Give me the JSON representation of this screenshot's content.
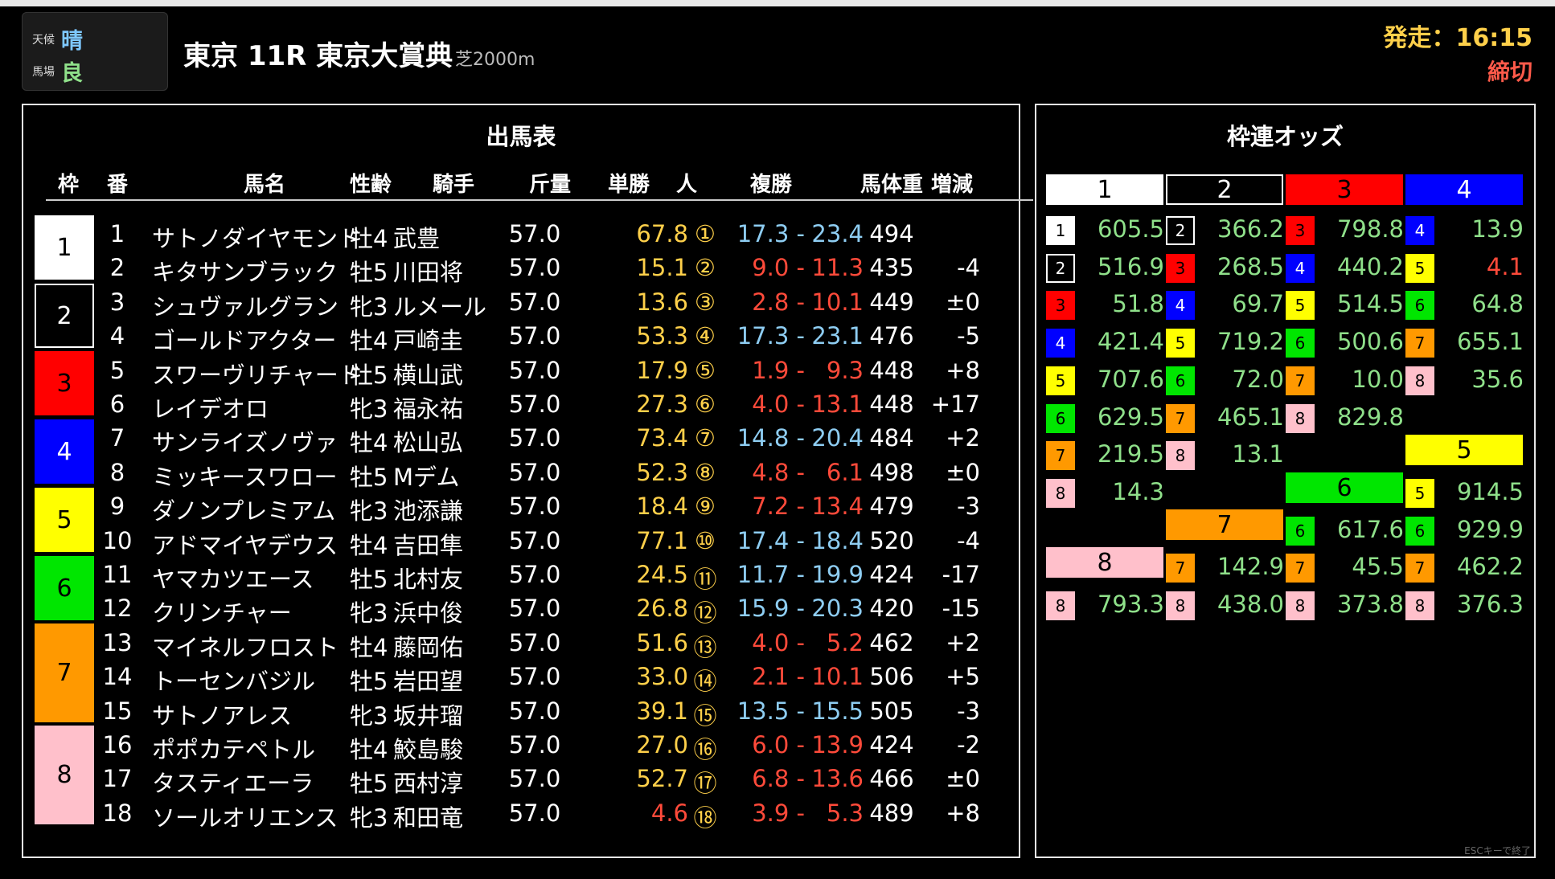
{
  "header": {
    "weather_label": "天候",
    "weather": "晴",
    "track_label": "馬場",
    "track": "良",
    "race_title": "東京 11R 東京大賞典",
    "course": "芝2000m",
    "start_time": "発走：16:15",
    "status": "締切",
    "esc_hint": "ESCキーで終了"
  },
  "colors": {
    "frame_1": "#ffffff",
    "frame_2": "#000000",
    "frame_3": "#ff0000",
    "frame_4": "#0000ff",
    "frame_5": "#ffff00",
    "frame_6": "#00e600",
    "frame_7": "#ff9900",
    "frame_8": "#ffc0cb",
    "odds_win": "#ffd04a",
    "odds_red": "#ff4a3a",
    "odds_blue": "#8ecdf2",
    "odds_green": "#8fe08a"
  },
  "race_table": {
    "title": "出馬表",
    "headers": {
      "frame": "枠",
      "number": "番",
      "name": "馬名",
      "sex_age": "性齢",
      "jockey": "騎手",
      "weight": "斤量",
      "win": "単勝",
      "popularity": "人",
      "place": "複勝",
      "body_weight": "馬体重",
      "diff": "増減"
    },
    "frames": [
      "1",
      "2",
      "3",
      "4",
      "5",
      "6",
      "7",
      "8"
    ],
    "rows": [
      {
        "num": "1",
        "name": "サトノダイヤモンド",
        "sex_age": "牡4",
        "jockey": "武豊",
        "weight": "57.0",
        "win": "67.8",
        "pop": "①",
        "place_low": "17.3 -",
        "place_high": "23.4",
        "body_weight": "494",
        "diff": ""
      },
      {
        "num": "2",
        "name": "キタサンブラック",
        "sex_age": "牡5",
        "jockey": "川田将",
        "weight": "57.0",
        "win": "15.1",
        "pop": "②",
        "place_low": "9.0 -",
        "place_high": "11.3",
        "body_weight": "435",
        "diff": "-4"
      },
      {
        "num": "3",
        "name": "シュヴァルグラン",
        "sex_age": "牝3",
        "jockey": "ルメール",
        "weight": "57.0",
        "win": "13.6",
        "pop": "③",
        "place_low": "2.8 -",
        "place_high": "10.1",
        "body_weight": "449",
        "diff": "±0"
      },
      {
        "num": "4",
        "name": "ゴールドアクター",
        "sex_age": "牡4",
        "jockey": "戸崎圭",
        "weight": "57.0",
        "win": "53.3",
        "pop": "④",
        "place_low": "17.3 -",
        "place_high": "23.1",
        "body_weight": "476",
        "diff": "-5"
      },
      {
        "num": "5",
        "name": "スワーヴリチャード",
        "sex_age": "牡5",
        "jockey": "横山武",
        "weight": "57.0",
        "win": "17.9",
        "pop": "⑤",
        "place_low": "1.9 -",
        "place_high": "9.3",
        "body_weight": "448",
        "diff": "+8"
      },
      {
        "num": "6",
        "name": "レイデオロ",
        "sex_age": "牝3",
        "jockey": "福永祐",
        "weight": "57.0",
        "win": "27.3",
        "pop": "⑥",
        "place_low": "4.0 -",
        "place_high": "13.1",
        "body_weight": "448",
        "diff": "+17"
      },
      {
        "num": "7",
        "name": "サンライズノヴァ",
        "sex_age": "牡4",
        "jockey": "松山弘",
        "weight": "57.0",
        "win": "73.4",
        "pop": "⑦",
        "place_low": "14.8 -",
        "place_high": "20.4",
        "body_weight": "484",
        "diff": "+2"
      },
      {
        "num": "8",
        "name": "ミッキースワロー",
        "sex_age": "牡5",
        "jockey": "Mデム",
        "weight": "57.0",
        "win": "52.3",
        "pop": "⑧",
        "place_low": "4.8 -",
        "place_high": "6.1",
        "body_weight": "498",
        "diff": "±0"
      },
      {
        "num": "9",
        "name": "ダノンプレミアム",
        "sex_age": "牝3",
        "jockey": "池添謙",
        "weight": "57.0",
        "win": "18.4",
        "pop": "⑨",
        "place_low": "7.2 -",
        "place_high": "13.4",
        "body_weight": "479",
        "diff": "-3"
      },
      {
        "num": "10",
        "name": "アドマイヤデウス",
        "sex_age": "牡4",
        "jockey": "吉田隼",
        "weight": "57.0",
        "win": "77.1",
        "pop": "⑩",
        "place_low": "17.4 -",
        "place_high": "18.4",
        "body_weight": "520",
        "diff": "-4"
      },
      {
        "num": "11",
        "name": "ヤマカツエース",
        "sex_age": "牡5",
        "jockey": "北村友",
        "weight": "57.0",
        "win": "24.5",
        "pop": "⑪",
        "place_low": "11.7 -",
        "place_high": "19.9",
        "body_weight": "424",
        "diff": "-17"
      },
      {
        "num": "12",
        "name": "クリンチャー",
        "sex_age": "牝3",
        "jockey": "浜中俊",
        "weight": "57.0",
        "win": "26.8",
        "pop": "⑫",
        "place_low": "15.9 -",
        "place_high": "20.3",
        "body_weight": "420",
        "diff": "-15"
      },
      {
        "num": "13",
        "name": "マイネルフロスト",
        "sex_age": "牡4",
        "jockey": "藤岡佑",
        "weight": "57.0",
        "win": "51.6",
        "pop": "⑬",
        "place_low": "4.0 -",
        "place_high": "5.2",
        "body_weight": "462",
        "diff": "+2"
      },
      {
        "num": "14",
        "name": "トーセンバジル",
        "sex_age": "牡5",
        "jockey": "岩田望",
        "weight": "57.0",
        "win": "33.0",
        "pop": "⑭",
        "place_low": "2.1 -",
        "place_high": "10.1",
        "body_weight": "506",
        "diff": "+5"
      },
      {
        "num": "15",
        "name": "サトノアレス",
        "sex_age": "牝3",
        "jockey": "坂井瑠",
        "weight": "57.0",
        "win": "39.1",
        "pop": "⑮",
        "place_low": "13.5 -",
        "place_high": "15.5",
        "body_weight": "505",
        "diff": "-3"
      },
      {
        "num": "16",
        "name": "ポポカテペトル",
        "sex_age": "牡4",
        "jockey": "鮫島駿",
        "weight": "57.0",
        "win": "27.0",
        "pop": "⑯",
        "place_low": "6.0 -",
        "place_high": "13.9",
        "body_weight": "424",
        "diff": "-2"
      },
      {
        "num": "17",
        "name": "タスティエーラ",
        "sex_age": "牡5",
        "jockey": "西村淳",
        "weight": "57.0",
        "win": "52.7",
        "pop": "⑰",
        "place_low": "6.8 -",
        "place_high": "13.6",
        "body_weight": "466",
        "diff": "±0"
      },
      {
        "num": "18",
        "name": "ソールオリエンス",
        "sex_age": "牝3",
        "jockey": "和田竜",
        "weight": "57.0",
        "win": "4.6",
        "pop": "⑱",
        "place_low": "3.9 -",
        "place_high": "5.3",
        "body_weight": "489",
        "diff": "+8"
      }
    ]
  },
  "odds": {
    "title": "枠連オッズ",
    "col_heads": [
      "1",
      "2",
      "3",
      "4"
    ],
    "inner_heads": [
      "5",
      "6",
      "7",
      "8"
    ],
    "col1": [
      {
        "box": "1",
        "val": "605.5"
      },
      {
        "box": "2",
        "val": "516.9"
      },
      {
        "box": "3",
        "val": "51.8"
      },
      {
        "box": "4",
        "val": "421.4"
      },
      {
        "box": "5",
        "val": "707.6"
      },
      {
        "box": "6",
        "val": "629.5"
      },
      {
        "box": "7",
        "val": "219.5"
      },
      {
        "box": "8",
        "val": "14.3"
      }
    ],
    "col2": [
      {
        "box": "2",
        "val": "366.2"
      },
      {
        "box": "3",
        "val": "268.5"
      },
      {
        "box": "4",
        "val": "69.7"
      },
      {
        "box": "5",
        "val": "719.2"
      },
      {
        "box": "6",
        "val": "72.0"
      },
      {
        "box": "7",
        "val": "465.1"
      },
      {
        "box": "8",
        "val": "13.1"
      }
    ],
    "col3": [
      {
        "box": "3",
        "val": "798.8"
      },
      {
        "box": "4",
        "val": "440.2"
      },
      {
        "box": "5",
        "val": "514.5"
      },
      {
        "box": "6",
        "val": "500.6"
      },
      {
        "box": "7",
        "val": "10.0"
      },
      {
        "box": "8",
        "val": "829.8"
      }
    ],
    "col4": [
      {
        "box": "4",
        "val": "13.9"
      },
      {
        "box": "5",
        "val": "4.1"
      },
      {
        "box": "6",
        "val": "64.8"
      },
      {
        "box": "7",
        "val": "655.1"
      },
      {
        "box": "8",
        "val": "35.6"
      }
    ],
    "f5": [
      {
        "box": "5",
        "val": "914.5"
      },
      {
        "box": "6",
        "val": "929.9"
      },
      {
        "box": "7",
        "val": "462.2"
      },
      {
        "box": "8",
        "val": "376.3"
      }
    ],
    "f6": [
      {
        "box": "6",
        "val": "617.6"
      },
      {
        "box": "7",
        "val": "45.5"
      },
      {
        "box": "8",
        "val": "373.8"
      }
    ],
    "f7": [
      {
        "box": "7",
        "val": "142.9"
      },
      {
        "box": "8",
        "val": "438.0"
      }
    ],
    "f8": [
      {
        "box": "8",
        "val": "793.3"
      }
    ]
  }
}
